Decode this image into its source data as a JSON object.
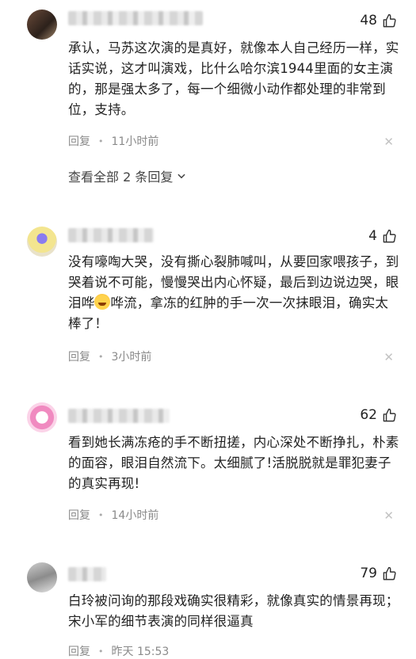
{
  "comments": [
    {
      "likes": "48",
      "text": "承认，马苏这次演的是真好，就像本人自己经历一样，实话实说，这才叫演戏，比什么哈尔滨1944里面的女主演的，那是强太多了，每一个细微小动作都处理的非常到位，支持。",
      "reply_label": "回复",
      "time": "11小时前",
      "more_replies": "查看全部 2 条回复"
    },
    {
      "likes": "4",
      "text_before_emoji": "没有嚎啕大哭，没有撕心裂肺喊叫，从要回家喂孩子，到哭着说不可能，慢慢哭出内心怀疑，最后到边说边哭，眼泪哗",
      "text_after_emoji": "哗流，拿冻的红肿的手一次一次抹眼泪，确实太棒了！",
      "reply_label": "回复",
      "time": "3小时前"
    },
    {
      "likes": "62",
      "text": "看到她长满冻疮的手不断扭搓，内心深处不断挣扎，朴素的面容，眼泪自然流下。太细腻了!活脱脱就是罪犯妻子的真实再现!",
      "reply_label": "回复",
      "time": "14小时前"
    },
    {
      "likes": "79",
      "text": "白玲被问询的那段戏确实很精彩，就像真实的情景再现；宋小军的细节表演的同样很逼真",
      "reply_label": "回复",
      "time": "昨天 15:53"
    }
  ],
  "icons": {
    "like": "thumbs-up-icon",
    "close": "close-icon",
    "expand": "chevron-down-icon"
  }
}
